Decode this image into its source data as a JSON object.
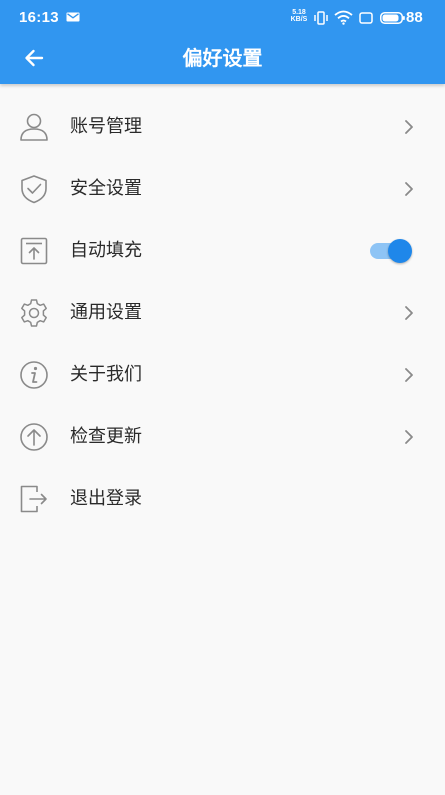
{
  "status_bar": {
    "time": "16:13",
    "net_speed_value": "5.18",
    "net_speed_unit": "KB/S",
    "battery": "88"
  },
  "app_bar": {
    "title": "偏好设置",
    "back_icon": "arrow-left-icon"
  },
  "colors": {
    "primary": "#3196f0",
    "toggle_on": "#1f87ea",
    "toggle_track": "#8ec4f5",
    "icon_stroke": "#8a8a8a",
    "background": "#f9f9f9"
  },
  "menu": {
    "items": [
      {
        "label": "账号管理",
        "icon": "user-icon",
        "trailing": "chevron"
      },
      {
        "label": "安全设置",
        "icon": "shield-check-icon",
        "trailing": "chevron"
      },
      {
        "label": "自动填充",
        "icon": "upload-box-icon",
        "trailing": "toggle",
        "toggle_on": true
      },
      {
        "label": "通用设置",
        "icon": "gear-icon",
        "trailing": "chevron"
      },
      {
        "label": "关于我们",
        "icon": "info-icon",
        "trailing": "chevron"
      },
      {
        "label": "检查更新",
        "icon": "arrow-up-circle-icon",
        "trailing": "chevron"
      },
      {
        "label": "退出登录",
        "icon": "logout-icon",
        "trailing": "none"
      }
    ]
  }
}
